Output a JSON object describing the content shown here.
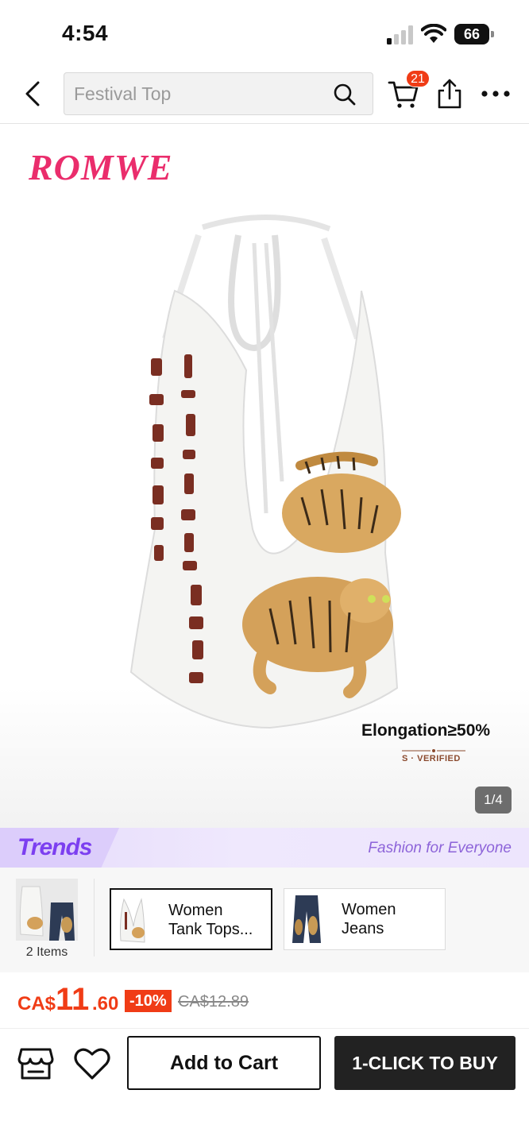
{
  "status_bar": {
    "time": "4:54",
    "battery": "66"
  },
  "nav": {
    "search_placeholder": "Festival Top",
    "cart_count": "21"
  },
  "gallery": {
    "brand": "ROMWE",
    "elongation": "Elongation≥50%",
    "verified": "S · VERIFIED",
    "page_counter": "1/4"
  },
  "trends": {
    "logo": "Trends",
    "tagline": "Fashion for Everyone"
  },
  "outfit": {
    "bundle_label": "2 Items",
    "categories": [
      {
        "line1": "Women",
        "line2": "Tank Tops..."
      },
      {
        "line1": "Women",
        "line2": "Jeans"
      }
    ]
  },
  "price": {
    "currency": "CA$",
    "integer": "11",
    "decimal": ".60",
    "discount": "-10%",
    "original": "CA$12.89"
  },
  "bottom": {
    "add_to_cart": "Add to Cart",
    "buy_now": "1-CLICK TO BUY"
  },
  "colors": {
    "accent": "#f03c16",
    "brand": "#ea2d6c",
    "trends_purple": "#7c3ff0",
    "dark": "#222222"
  }
}
